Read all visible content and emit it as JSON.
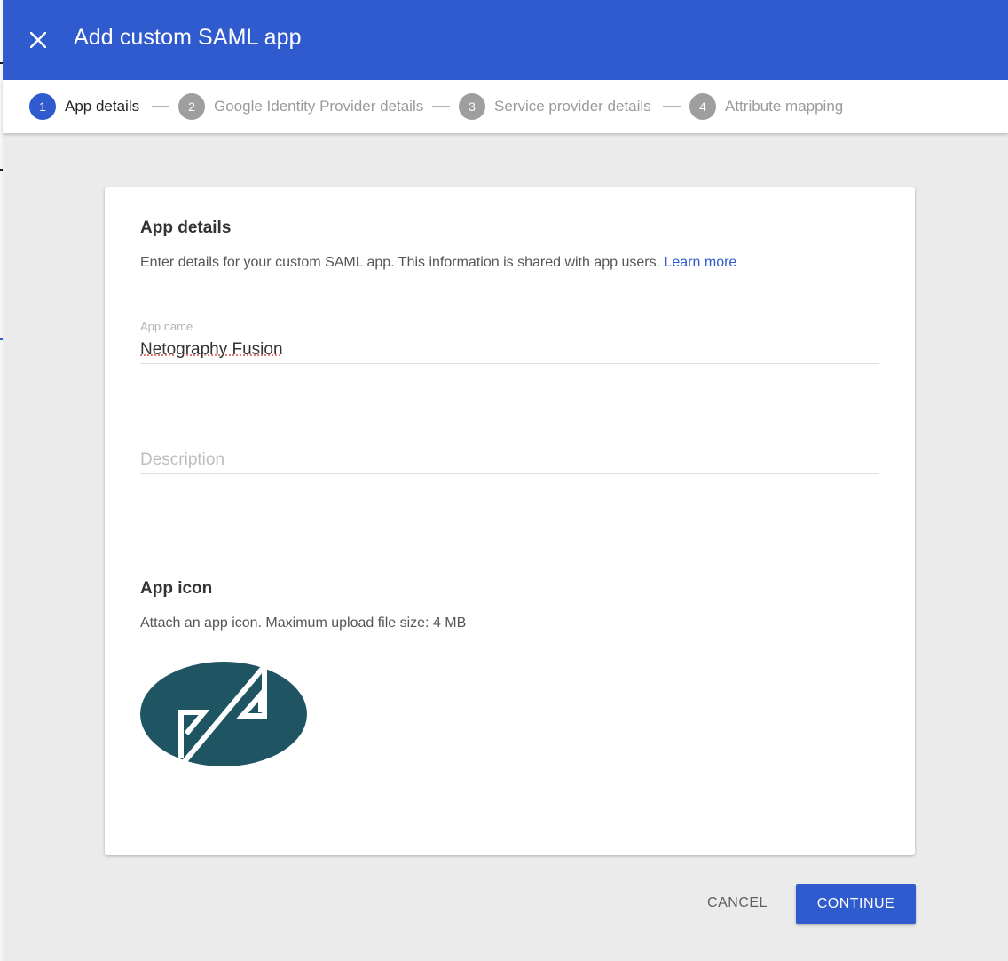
{
  "header": {
    "title": "Add custom SAML app",
    "close_icon": "close-icon",
    "background_color": "#2f5bce"
  },
  "stepper": {
    "steps": [
      {
        "number": "1",
        "label": "App details",
        "active": true
      },
      {
        "number": "2",
        "label": "Google Identity Provider details",
        "active": false
      },
      {
        "number": "3",
        "label": "Service provider details",
        "active": false
      },
      {
        "number": "4",
        "label": "Attribute mapping",
        "active": false
      }
    ]
  },
  "app_details": {
    "heading": "App details",
    "description": "Enter details for your custom SAML app. This information is shared with app users.",
    "learn_more": "Learn more",
    "app_name_label": "App name",
    "app_name_value": "Netography Fusion",
    "description_placeholder": "Description"
  },
  "app_icon": {
    "heading": "App icon",
    "description": "Attach an app icon. Maximum upload file size: 4 MB",
    "logo_color": "#1f5562"
  },
  "actions": {
    "cancel_label": "CANCEL",
    "continue_label": "CONTINUE",
    "accent_color": "#2f5bce"
  }
}
